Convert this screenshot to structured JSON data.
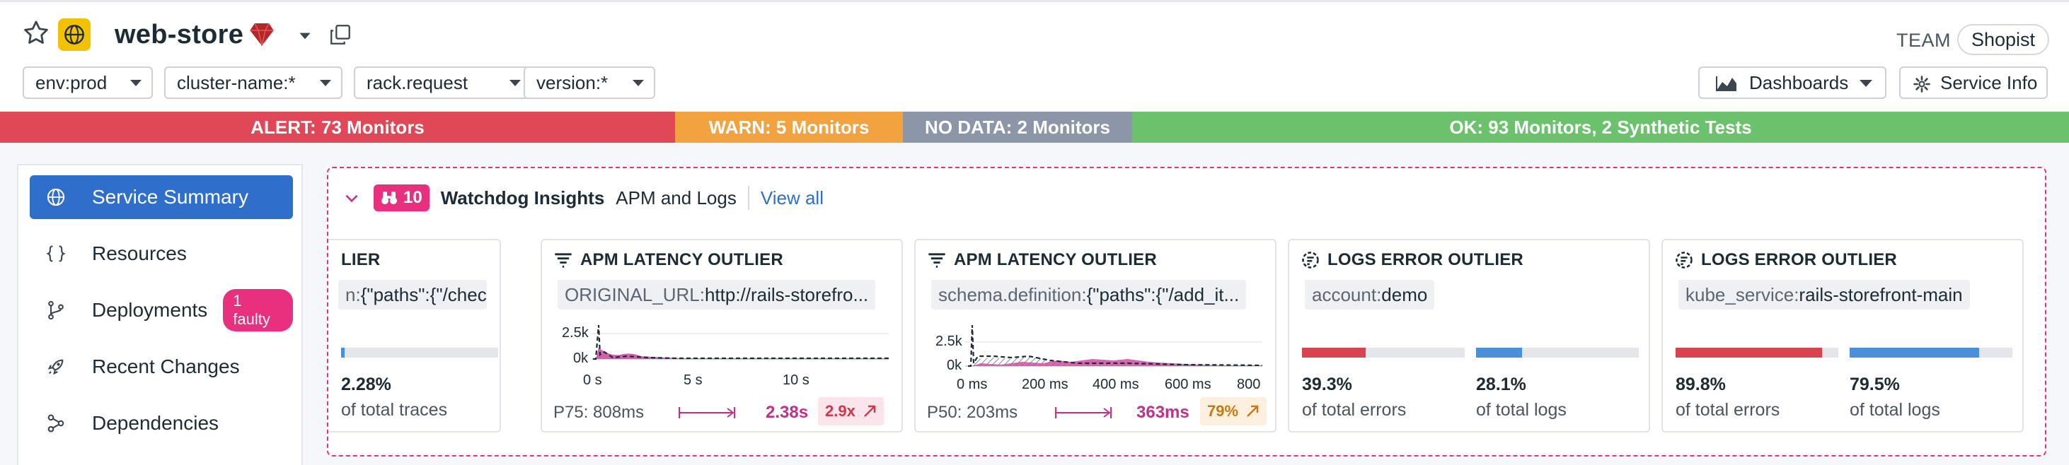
{
  "header": {
    "service_name": "web-store",
    "team_label": "TEAM",
    "team_name": "Shopist"
  },
  "filters": [
    {
      "value": "env:prod"
    },
    {
      "value": "cluster-name:*"
    },
    {
      "value": "rack.request"
    },
    {
      "value": "version:*"
    }
  ],
  "actions": {
    "dashboards_label": "Dashboards",
    "service_info_label": "Service Info"
  },
  "monitor_status": {
    "alert": "ALERT: 73 Monitors",
    "warn": "WARN: 5 Monitors",
    "no_data": "NO DATA: 2 Monitors",
    "ok": "OK: 93 Monitors, 2 Synthetic Tests",
    "colors": {
      "alert": "#e04858",
      "warn": "#f2a23e",
      "no_data": "#8d96a8",
      "ok": "#6cc26c"
    }
  },
  "sidebar": {
    "items": [
      {
        "label": "Service Summary",
        "icon": "globe-icon",
        "active": true
      },
      {
        "label": "Resources",
        "icon": "braces-icon"
      },
      {
        "label": "Deployments",
        "icon": "branch-icon",
        "badge": "1 faulty"
      },
      {
        "label": "Recent Changes",
        "icon": "rocket-icon"
      },
      {
        "label": "Dependencies",
        "icon": "dependencies-icon"
      }
    ]
  },
  "watchdog": {
    "count": "10",
    "title": "Watchdog Insights",
    "subtitle": "APM and Logs",
    "view_all": "View all",
    "cards": [
      {
        "type": "partial",
        "header": "LIER",
        "tag_key": "n:",
        "tag_value": "{\"paths\":{\"/check...",
        "pct": "2.28%",
        "pct_fraction": 0.0228,
        "desc": "of total traces"
      },
      {
        "type": "latency",
        "header": "APM LATENCY OUTLIER",
        "tag_key": "ORIGINAL_URL:",
        "tag_value": "http://rails-storefro...",
        "y_tick": "2.5k",
        "y_zero": "0k",
        "x_ticks": [
          "0 s",
          "5 s",
          "10 s"
        ],
        "pl_label": "P75: 808ms",
        "value": "2.38s",
        "ratio": "2.9x"
      },
      {
        "type": "latency",
        "header": "APM LATENCY OUTLIER",
        "tag_key": "schema.definition:",
        "tag_value": "{\"paths\":{\"/add_it...",
        "y_tick": "2.5k",
        "y_zero": "0k",
        "x_ticks": [
          "0 ms",
          "200 ms",
          "400 ms",
          "600 ms",
          "800"
        ],
        "pl_label": "P50: 203ms",
        "value": "363ms",
        "ratio": "79%"
      },
      {
        "type": "logs",
        "header": "LOGS ERROR OUTLIER",
        "tag_key": "account:",
        "tag_value": "demo",
        "pct1": "39.3%",
        "pct1_fraction": 0.393,
        "desc1": "of total errors",
        "pct2": "28.1%",
        "pct2_fraction": 0.281,
        "desc2": "of total logs"
      },
      {
        "type": "logs",
        "header": "LOGS ERROR OUTLIER",
        "tag_key": "kube_service:",
        "tag_value": "rails-storefront-main",
        "pct1": "89.8%",
        "pct1_fraction": 0.898,
        "desc1": "of total errors",
        "pct2": "79.5%",
        "pct2_fraction": 0.795,
        "desc2": "of total logs"
      }
    ]
  }
}
